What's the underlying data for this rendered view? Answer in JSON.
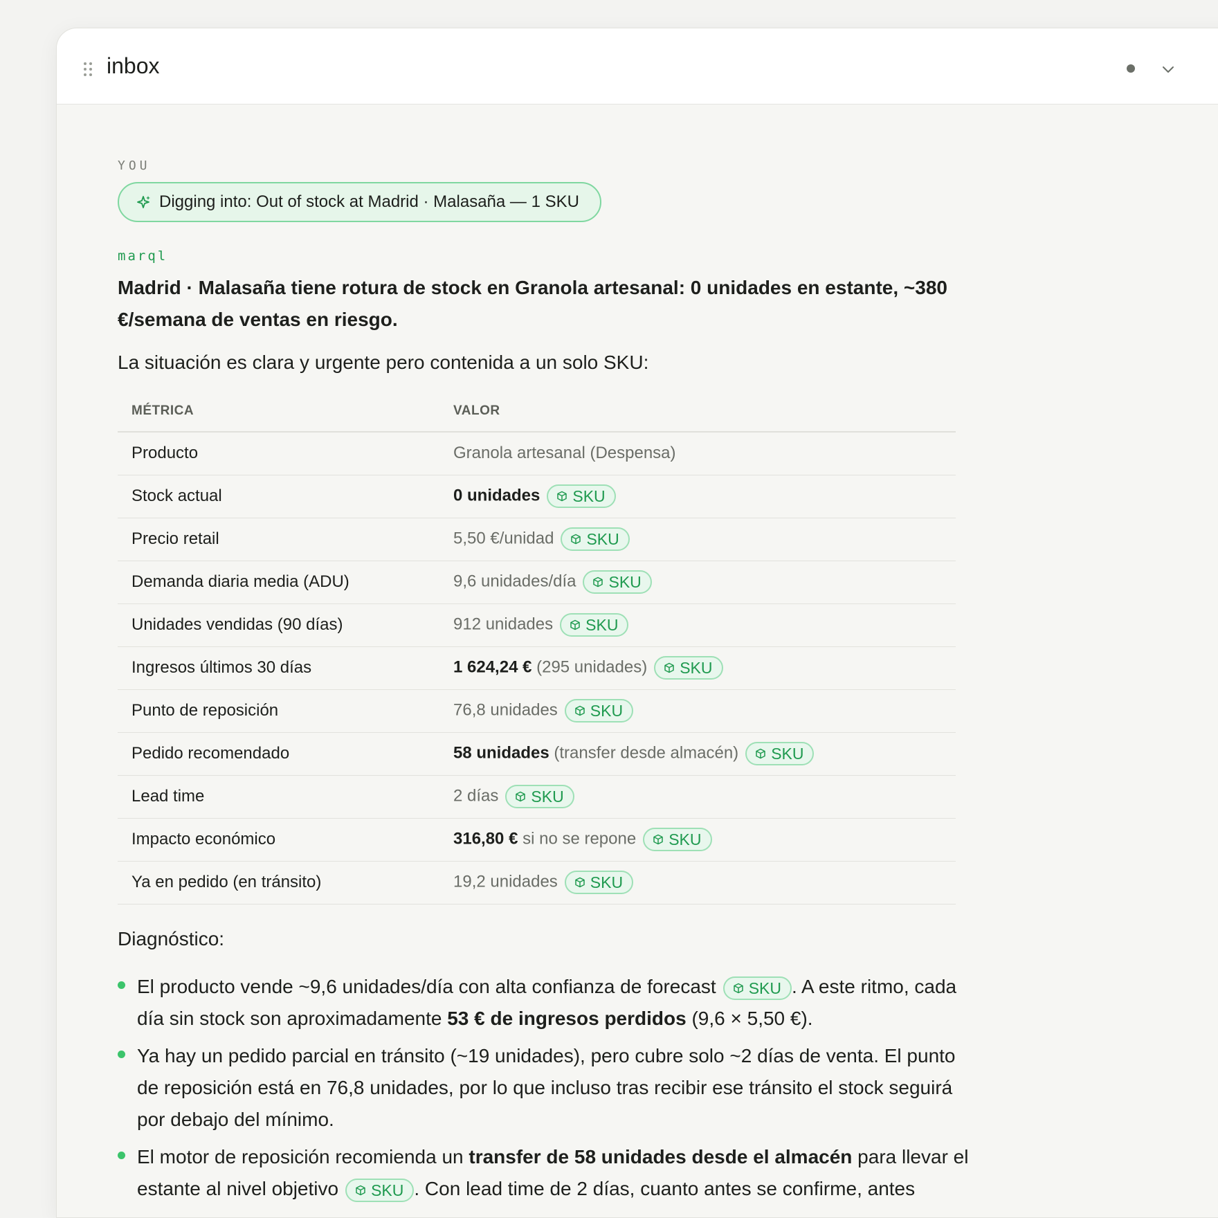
{
  "window": {
    "title": "inbox"
  },
  "conversation": {
    "user_role": "YOU",
    "context_pill": "Digging into: Out of stock at Madrid · Malasaña — 1 SKU",
    "assistant_role": "marql",
    "headline": "Madrid · Malasaña tiene rotura de stock en Granola artesanal: 0 unidades en estante, ~380 €/semana de ventas en riesgo.",
    "intro": "La situación es clara y urgente pero contenida a un solo SKU:",
    "sku_label": "SKU",
    "table": {
      "headers": [
        "MÉTRICA",
        "VALOR"
      ],
      "rows": [
        {
          "metric": "Producto",
          "value_strong": "",
          "value_rest": "Granola artesanal (Despensa)"
        },
        {
          "metric": "Stock actual",
          "value_strong": "0 unidades",
          "value_rest": ""
        },
        {
          "metric": "Precio retail",
          "value_strong": "",
          "value_rest": "5,50 €/unidad"
        },
        {
          "metric": "Demanda diaria media (ADU)",
          "value_strong": "",
          "value_rest": "9,6 unidades/día"
        },
        {
          "metric": "Unidades vendidas (90 días)",
          "value_strong": "",
          "value_rest": "912 unidades"
        },
        {
          "metric": "Ingresos últimos 30 días",
          "value_strong": "1 624,24 €",
          "value_rest": " (295 unidades)"
        },
        {
          "metric": "Punto de reposición",
          "value_strong": "",
          "value_rest": "76,8 unidades"
        },
        {
          "metric": "Pedido recomendado",
          "value_strong": "58 unidades",
          "value_rest": " (transfer desde almacén)"
        },
        {
          "metric": "Lead time",
          "value_strong": "",
          "value_rest": "2 días"
        },
        {
          "metric": "Impacto económico",
          "value_strong": "316,80 €",
          "value_rest": " si no se repone"
        },
        {
          "metric": "Ya en pedido (en tránsito)",
          "value_strong": "",
          "value_rest": "19,2 unidades"
        }
      ]
    },
    "diagnosis_title": "Diagnóstico:",
    "bullets": [
      {
        "a": "El producto vende ~9,6 unidades/día con alta confianza de forecast",
        "b": ". A este ritmo, cada día sin stock son aproximadamente ",
        "strong": "53 € de ingresos perdidos",
        "c": " (9,6 × 5,50 €)."
      },
      {
        "text": "Ya hay un pedido parcial en tránsito (~19 unidades), pero cubre solo ~2 días de venta. El punto de reposición está en 76,8 unidades, por lo que incluso tras recibir ese tránsito el stock seguirá por debajo del mínimo."
      },
      {
        "a": "El motor de reposición recomienda un ",
        "strong": "transfer de 58 unidades desde el almacén",
        "b": " para llevar el estante al nivel objetivo",
        "c": ". Con lead time de 2 días, cuanto antes se confirme, antes"
      }
    ]
  },
  "colors": {
    "accent": "#1f9a4f",
    "pill_bg": "#e8f7ed",
    "pill_border": "#9ee0b6",
    "bullet": "#3cc46b"
  }
}
